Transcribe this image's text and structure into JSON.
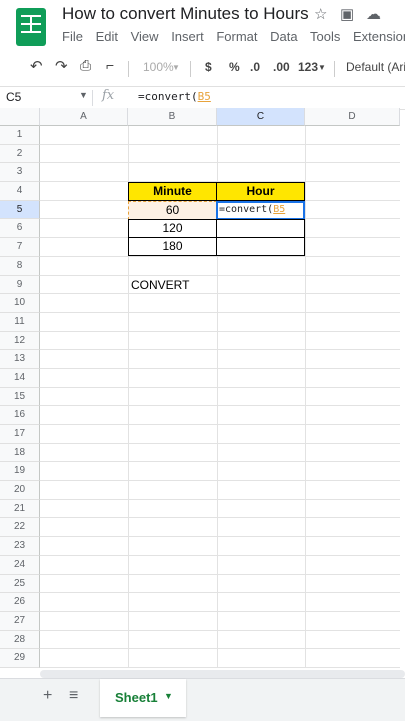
{
  "app": {
    "doc_title": "How to convert Minutes to Hours",
    "menu": [
      "File",
      "Edit",
      "View",
      "Insert",
      "Format",
      "Data",
      "Tools",
      "Extensions"
    ]
  },
  "toolbar": {
    "zoom": "100%",
    "currency": "$",
    "percent": "%",
    "dec_decrease": ".0",
    "dec_increase": ".00",
    "more_formats": "123",
    "font": "Default (Ari..."
  },
  "formula_bar": {
    "name_box": "C5",
    "fx": "fx",
    "formula_prefix": "=convert(",
    "formula_ref": "B5"
  },
  "columns": [
    "A",
    "B",
    "C",
    "D"
  ],
  "rows": [
    "1",
    "2",
    "3",
    "4",
    "5",
    "6",
    "7",
    "8",
    "9",
    "10",
    "11",
    "12",
    "13",
    "14",
    "15",
    "16",
    "17",
    "18",
    "19",
    "20",
    "21",
    "22",
    "23",
    "24",
    "25",
    "26",
    "27",
    "28",
    "29"
  ],
  "table": {
    "header_minute": "Minute",
    "header_hour": "Hour",
    "minutes": [
      "60",
      "120",
      "180"
    ],
    "editing_prefix": "=convert(",
    "editing_ref": "B5"
  },
  "convert_label": "CONVERT",
  "sheets": {
    "add": "+",
    "list": "≡",
    "active": "Sheet1"
  },
  "colors": {
    "header_fill": "#ffe600",
    "selection_blue": "#1a73e8",
    "ref_orange": "#e8a33b",
    "sheets_green": "#0f9d58"
  }
}
